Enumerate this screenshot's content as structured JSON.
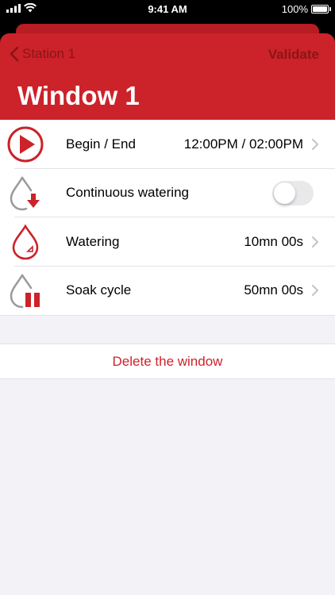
{
  "status_bar": {
    "time": "9:41 AM",
    "battery": "100%"
  },
  "nav": {
    "back_label": "Station 1",
    "validate_label": "Validate",
    "title": "Window 1"
  },
  "rows": [
    {
      "label": "Begin / End",
      "value": "12:00PM / 02:00PM",
      "icon": "play-icon"
    },
    {
      "label": "Continuous watering",
      "toggle_on": false,
      "icon": "drop-arrow-icon"
    },
    {
      "label": "Watering",
      "value": "10mn 00s",
      "icon": "drop-icon"
    },
    {
      "label": "Soak cycle",
      "value": "50mn 00s",
      "icon": "drop-pause-icon"
    }
  ],
  "delete_label": "Delete the window",
  "colors": {
    "accent": "#cc2229",
    "header_dark": "#8a1518",
    "destructive": "#d0202a"
  }
}
